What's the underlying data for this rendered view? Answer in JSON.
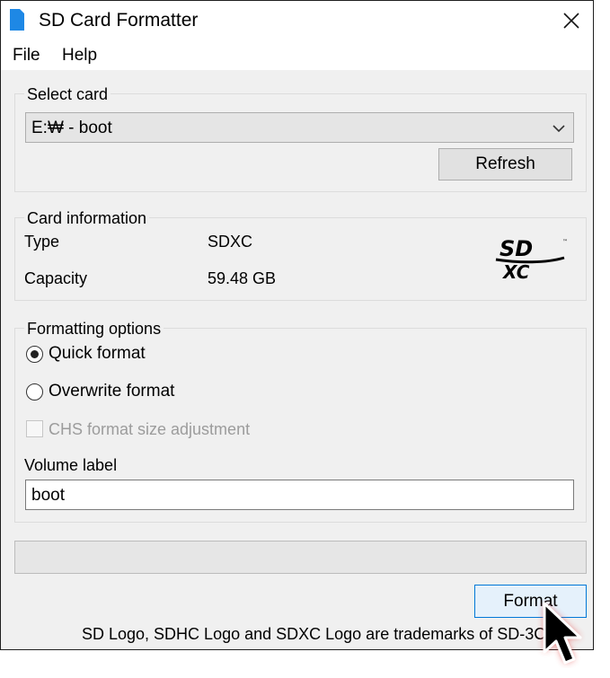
{
  "window": {
    "title": "SD Card Formatter"
  },
  "menu": {
    "items": [
      "File",
      "Help"
    ]
  },
  "select_card": {
    "group_title": "Select card",
    "selected": "E:₩ - boot",
    "refresh_label": "Refresh"
  },
  "card_info": {
    "group_title": "Card information",
    "type_label": "Type",
    "type_value": "SDXC",
    "capacity_label": "Capacity",
    "capacity_value": "59.48 GB",
    "logo": "SDXC"
  },
  "format_options": {
    "group_title": "Formatting options",
    "quick_label": "Quick format",
    "quick_checked": true,
    "overwrite_label": "Overwrite format",
    "overwrite_checked": false,
    "chs_label": "CHS format size adjustment",
    "chs_checked": false,
    "chs_enabled": false,
    "volume_label_title": "Volume label",
    "volume_label_value": "boot"
  },
  "progress": {
    "value": 0
  },
  "actions": {
    "format_label": "Format"
  },
  "footer": {
    "trademark_text": "SD Logo, SDHC Logo and SDXC Logo are trademarks of SD-3C, ..."
  },
  "colors": {
    "window_bg": "#f0f0f0",
    "titlebar_bg": "#ffffff",
    "sd_icon": "#1e88e5",
    "cursor_glow": "#e53935"
  },
  "icons": {
    "app": "sd-card-icon",
    "close": "close-icon",
    "dropdown": "chevron-down-icon"
  }
}
